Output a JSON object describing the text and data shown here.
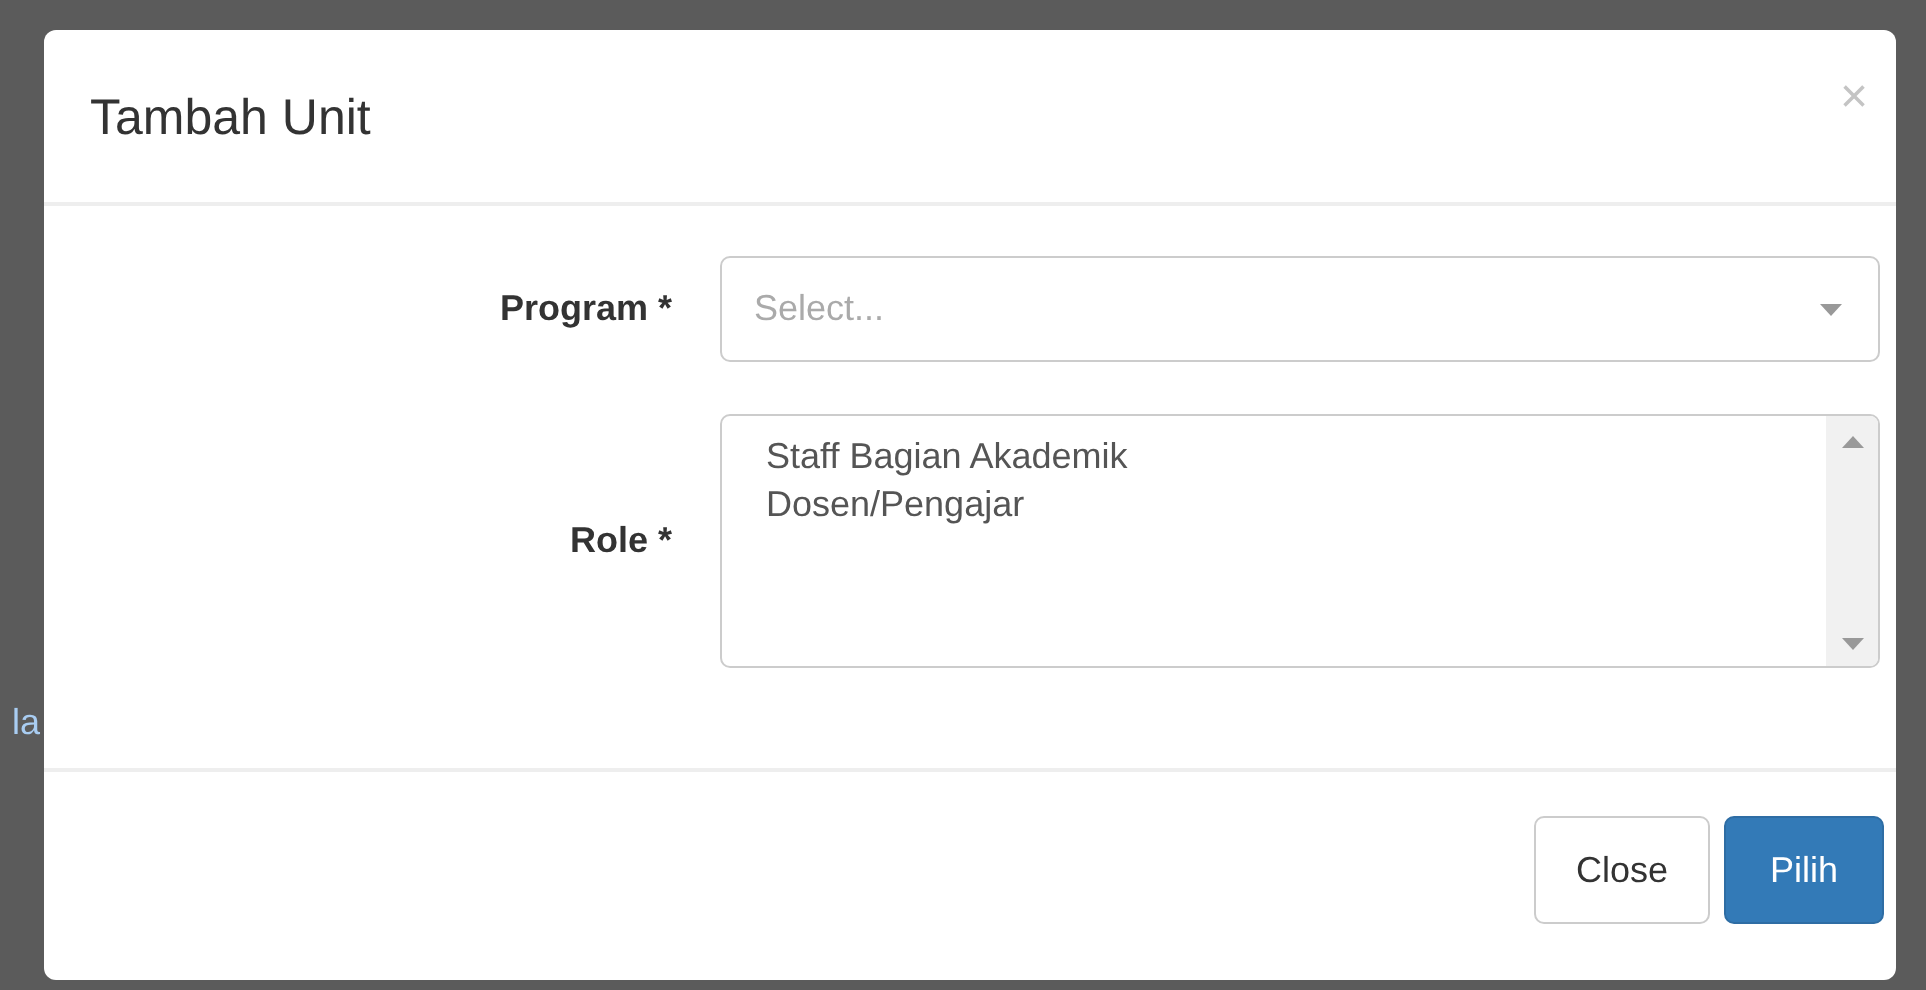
{
  "background": {
    "partial_text": "la"
  },
  "dialog": {
    "title": "Tambah Unit",
    "close_icon": "×"
  },
  "fields": [
    {
      "kind": "select",
      "label": "Program *",
      "placeholder": "Select..."
    },
    {
      "kind": "listbox",
      "label": "Role *",
      "options": [
        {
          "label": "Staff Bagian Akademik",
          "selected": false
        },
        {
          "label": "Dosen/Pengajar",
          "selected": false
        }
      ]
    }
  ],
  "buttons": [
    {
      "label": "Close",
      "kind": "default"
    },
    {
      "label": "Pilih",
      "kind": "primary"
    }
  ]
}
